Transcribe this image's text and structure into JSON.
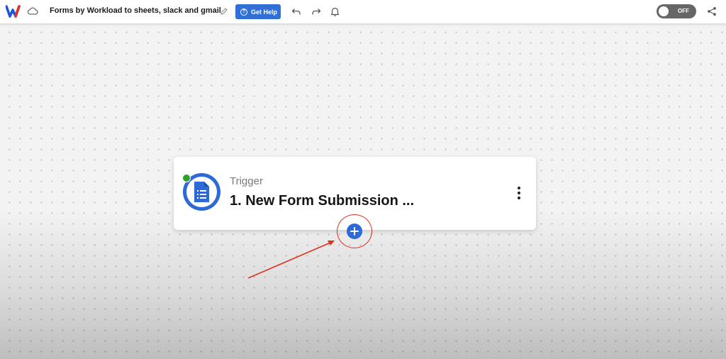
{
  "app": {
    "title": "Forms by Workload to sheets, slack and gmail",
    "logo_icon": "workload-logo-icon",
    "brand_colors": [
      "#1e57d6",
      "#e8302a"
    ]
  },
  "toolbar": {
    "help_label": "Get Help",
    "help_icon": "question-circle-icon",
    "undo_icon": "undo-icon",
    "redo_icon": "redo-icon",
    "bell_icon": "bell-icon",
    "toggle_label": "OFF",
    "share_icon": "share-icon"
  },
  "trigger_card": {
    "label": "Trigger",
    "title": "1. New Form Submission ...",
    "app_icon": "form-document-icon",
    "status": "active",
    "status_color": "#2e9e2e",
    "menu_icon": "more-vertical-icon"
  },
  "add_step": {
    "icon": "plus-icon",
    "color": "#2d6ad8"
  },
  "annotation": {
    "color": "#e0301e"
  }
}
